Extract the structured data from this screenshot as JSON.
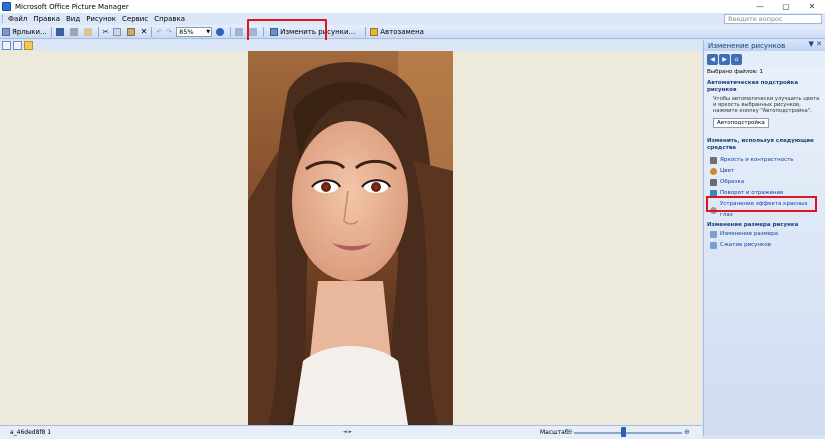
{
  "window": {
    "title": "Microsoft Office Picture Manager",
    "controls": [
      "—",
      "▢",
      "✕"
    ]
  },
  "menu": {
    "items": [
      "Файл",
      "Правка",
      "Вид",
      "Рисунок",
      "Сервис",
      "Справка"
    ],
    "help_placeholder": "Введите вопрос"
  },
  "toolbar": {
    "shortcuts_label": "Ярлыки...",
    "zoom_value": "85%",
    "edit_pictures_label": "Изменить рисунки...",
    "autofix_label": "Автозамена"
  },
  "task_pane": {
    "title": "Изменение рисунков",
    "selected_files": "Выбрано файлов: 1",
    "autofix_heading": "Автоматическая подстройка рисунков",
    "autofix_desc": "Чтобы автоматически улучшить цвета и яркость выбранных рисунков, нажмите кнопку \"Автоподстройка\".",
    "autofix_button": "Автоподстройка",
    "tools_heading": "Изменить, используя следующие средства",
    "tools": [
      "Яркость и контрастность",
      "Цвет",
      "Обрезка",
      "Поворот и отражение",
      "Устранение эффекта красных глаз"
    ],
    "resize_heading": "Изменение размера рисунка",
    "resize_tools": [
      "Изменение размера",
      "Сжатие рисунков"
    ]
  },
  "status": {
    "filename": "a_46ded8f8 1",
    "zoom_label": "Масштаб:"
  },
  "colors": {
    "highlight": "#e0161d",
    "link": "#0b3fa3",
    "toolbar": "#c9daf3"
  }
}
